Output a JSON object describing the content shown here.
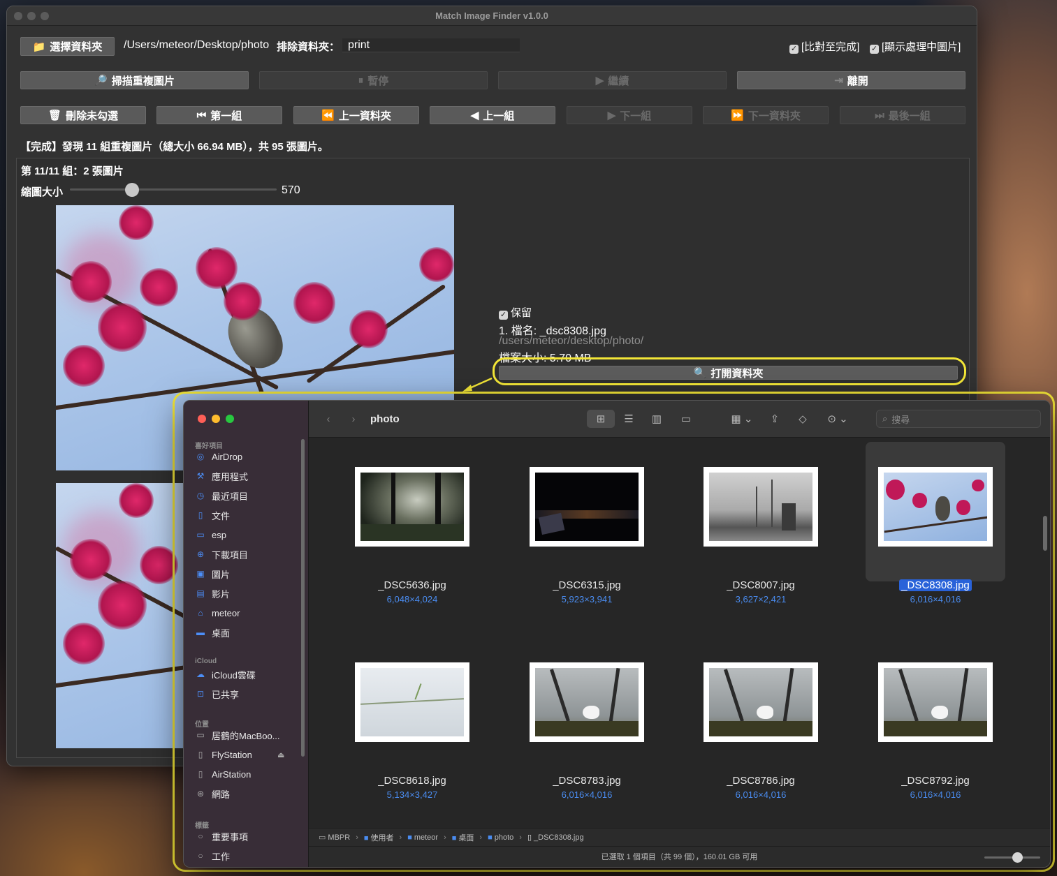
{
  "app": {
    "title": "Match Image Finder v1.0.0",
    "choose_folder": "選擇資料夾",
    "path": "/Users/meteor/Desktop/photo",
    "exclude_label": "排除資料夾：",
    "exclude_value": "print",
    "option_done": "[比對至完成]",
    "option_show": "[顯示處理中圖片]",
    "scan": "掃描重複圖片",
    "pause": "暫停",
    "resume": "繼續",
    "quit": "離開",
    "delete_unchecked": "刪除未勾選",
    "first_group": "第一組",
    "prev_folder": "上一資料夾",
    "prev_group": "上一組",
    "next_group": "下一組",
    "next_folder": "下一資料夾",
    "last_group": "最後一組",
    "status": "【完成】發現 11 組重複圖片（總大小 66.94 MB），共 95 張圖片。",
    "group_title": "第 11/11 組：2 張圖片",
    "thumb_label": "縮圖大小",
    "thumb_value": "570",
    "thumb_fraction": 0.3,
    "keep_label": "保留",
    "file_name": "1. 檔名: _dsc8308.jpg",
    "file_path": "/users/meteor/desktop/photo/",
    "file_size": "檔案大小: 5.70 MB",
    "open_folder": "打開資料夾"
  },
  "finder": {
    "title": "photo",
    "search_placeholder": "搜尋",
    "sidebar": {
      "favorites_header": "喜好項目",
      "favorites": [
        {
          "label": "AirDrop",
          "icon": "airdrop-icon"
        },
        {
          "label": "應用程式",
          "icon": "applications-icon"
        },
        {
          "label": "最近項目",
          "icon": "clock-icon"
        },
        {
          "label": "文件",
          "icon": "document-icon"
        },
        {
          "label": "esp",
          "icon": "folder-icon"
        },
        {
          "label": "下載項目",
          "icon": "download-icon"
        },
        {
          "label": "圖片",
          "icon": "pictures-icon"
        },
        {
          "label": "影片",
          "icon": "film-icon"
        },
        {
          "label": "meteor",
          "icon": "home-icon"
        },
        {
          "label": "桌面",
          "icon": "desktop-icon"
        }
      ],
      "icloud_header": "iCloud",
      "icloud": [
        {
          "label": "iCloud雲碟",
          "icon": "cloud-icon"
        },
        {
          "label": "已共享",
          "icon": "shared-folder-icon"
        }
      ],
      "locations_header": "位置",
      "locations": [
        {
          "label": "居鶴的MacBoo...",
          "icon": "laptop-icon"
        },
        {
          "label": "FlyStation",
          "icon": "document-icon"
        },
        {
          "label": "AirStation",
          "icon": "document-icon"
        },
        {
          "label": "網路",
          "icon": "globe-icon"
        }
      ],
      "tags_header": "標籤",
      "tags": [
        {
          "label": "重要事項",
          "icon": "tag-circle-icon"
        },
        {
          "label": "工作",
          "icon": "tag-circle-icon"
        }
      ]
    },
    "files": [
      {
        "name": "_DSC5636.jpg",
        "dims": "6,048×4,024",
        "kind": "forest"
      },
      {
        "name": "_DSC6315.jpg",
        "dims": "5,923×3,941",
        "kind": "night"
      },
      {
        "name": "_DSC8007.jpg",
        "dims": "3,627×2,421",
        "kind": "windmill"
      },
      {
        "name": "_DSC8308.jpg",
        "dims": "6,016×4,016",
        "kind": "bird",
        "selected": true
      },
      {
        "name": "_DSC8618.jpg",
        "dims": "5,134×3,427",
        "kind": "snow"
      },
      {
        "name": "_DSC8783.jpg",
        "dims": "6,016×4,016",
        "kind": "egret"
      },
      {
        "name": "_DSC8786.jpg",
        "dims": "6,016×4,016",
        "kind": "egret"
      },
      {
        "name": "_DSC8792.jpg",
        "dims": "6,016×4,016",
        "kind": "egret"
      }
    ],
    "path": [
      "MBPR",
      "使用者",
      "meteor",
      "桌面",
      "photo",
      "_DSC8308.jpg"
    ],
    "status": "已選取 1 個項目（共 99 個），160.01 GB 可用",
    "colors": {
      "accent": "#4a8cf0",
      "highlight": "#f3e637"
    }
  }
}
